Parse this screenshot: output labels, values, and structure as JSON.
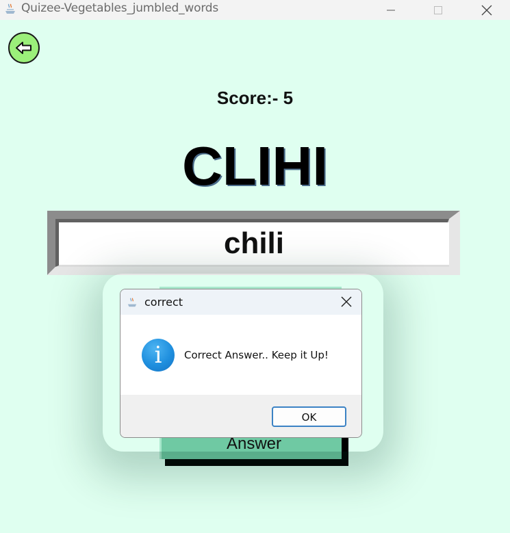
{
  "window": {
    "title": "Quizee-Vegetables_jumbled_words",
    "app_icon": "java-app-icon",
    "minimize_icon": "minimize-icon",
    "maximize_icon": "maximize-icon",
    "close_icon": "close-icon"
  },
  "game": {
    "back_icon": "back-arrow-icon",
    "score": "Score:- 5",
    "jumbled_word": "CLIHI",
    "answer_value": "chili",
    "answer_button_label": "Answer"
  },
  "dialog": {
    "title": "correct",
    "icon": "info-icon",
    "message": "Correct Answer.. Keep it Up!",
    "ok_label": "OK"
  },
  "colors": {
    "background": "#dffff0",
    "back_button": "#9bef7a",
    "answer_button": "#6fc9a3",
    "ok_border": "#3b82c4"
  }
}
